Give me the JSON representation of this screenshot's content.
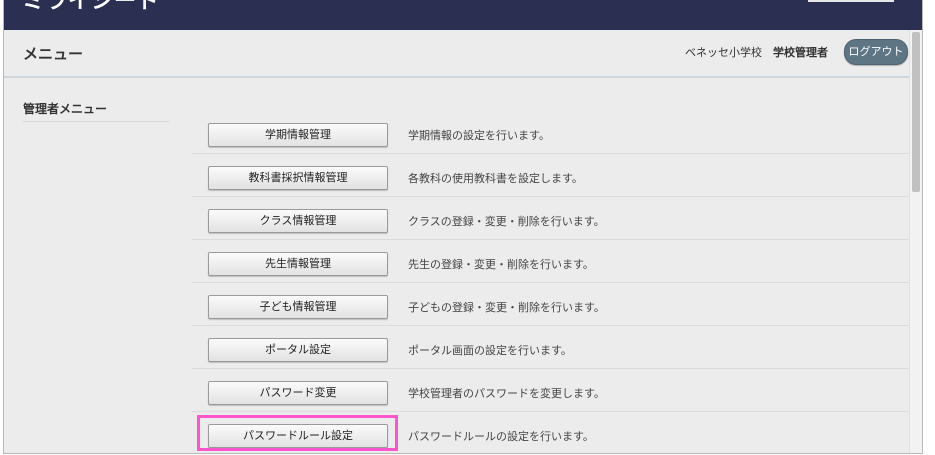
{
  "app": {
    "logo": "ミライシード"
  },
  "header": {
    "title": "メニュー",
    "school_name": "ベネッセ小学校",
    "role": "学校管理者",
    "logout_label": "ログアウト"
  },
  "sidebar": {
    "title": "管理者メニュー"
  },
  "menu": {
    "items": [
      {
        "label": "学期情報管理",
        "description": "学期情報の設定を行います。"
      },
      {
        "label": "教科書採択情報管理",
        "description": "各教科の使用教科書を設定します。"
      },
      {
        "label": "クラス情報管理",
        "description": "クラスの登録・変更・削除を行います。"
      },
      {
        "label": "先生情報管理",
        "description": "先生の登録・変更・削除を行います。"
      },
      {
        "label": "子ども情報管理",
        "description": "子どもの登録・変更・削除を行います。"
      },
      {
        "label": "ポータル設定",
        "description": "ポータル画面の設定を行います。"
      },
      {
        "label": "パスワード変更",
        "description": "学校管理者のパスワードを変更します。"
      },
      {
        "label": "パスワードルール設定",
        "description": "パスワードルールの設定を行います。"
      }
    ]
  },
  "highlight": {
    "target": "パスワードルール設定",
    "color": "#ff55cc"
  },
  "colors": {
    "topbar": "#2b2f52",
    "logout_button": "#5e7584",
    "background": "#ececec"
  }
}
